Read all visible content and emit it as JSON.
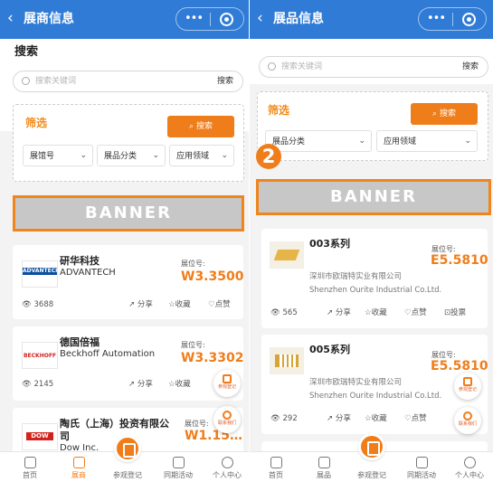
{
  "left": {
    "nav": {
      "back": "‹",
      "title": "展商信息",
      "dots": "•••"
    },
    "search": {
      "title": "搜索",
      "placeholder": "搜索关键词",
      "button": "搜索"
    },
    "filter": {
      "title": "筛选",
      "search_button": "搜索",
      "dropdowns": [
        "展馆号",
        "展品分类",
        "应用领域"
      ]
    },
    "banner": "BANNER",
    "booth_label": "展位号:",
    "cards": [
      {
        "name_cn": "研华科技",
        "name_en": "ADVANTECH",
        "logo": "ADVANTECH",
        "booth": "W3.3500",
        "views": "3688",
        "share": "分享",
        "fav": "收藏",
        "like": "点赞"
      },
      {
        "name_cn": "德国倍福",
        "name_en": "Beckhoff Automation",
        "logo": "BECKHOFF",
        "booth": "W3.3302",
        "views": "2145",
        "share": "分享",
        "fav": "收藏"
      },
      {
        "name_cn": "陶氏（上海）投资有限公",
        "name_cn2": "司",
        "name_en": "Dow Inc.",
        "logo": "DOW",
        "booth": "W1.15…"
      }
    ],
    "float_buttons": [
      "参观登记",
      "联系我们"
    ],
    "tabs": [
      {
        "label": "首页",
        "icon": "home-icon"
      },
      {
        "label": "展商",
        "icon": "exhibitor-icon"
      },
      {
        "label": "参观登记",
        "icon": "register-icon"
      },
      {
        "label": "同期活动",
        "icon": "event-icon"
      },
      {
        "label": "个人中心",
        "icon": "user-icon"
      }
    ],
    "active_tab": 1
  },
  "right": {
    "nav": {
      "back": "‹",
      "title": "展品信息",
      "dots": "•••"
    },
    "search": {
      "placeholder": "搜索关键词",
      "button": "搜索"
    },
    "filter": {
      "title": "筛选",
      "search_button": "搜索",
      "dropdowns": [
        "展品分类",
        "应用领域"
      ]
    },
    "step_badge": "2",
    "banner": "BANNER",
    "booth_label": "展位号:",
    "cards": [
      {
        "name": "003系列",
        "booth": "E5.5810",
        "company_cn": "深圳市欧瑞特实业有限公司",
        "company_en": "Shenzhen Ourite Industrial Co.Ltd.",
        "views": "565",
        "share": "分享",
        "fav": "收藏",
        "like": "点赞",
        "vote": "投票"
      },
      {
        "name": "005系列",
        "booth": "E5.5810",
        "company_cn": "深圳市欧瑞特实业有限公司",
        "company_en": "Shenzhen Ourite Industrial Co.Ltd.",
        "views": "292",
        "share": "分享",
        "fav": "收藏",
        "like": "点赞"
      }
    ],
    "float_buttons": [
      "参观登记",
      "联系我们"
    ],
    "tabs": [
      {
        "label": "首页",
        "icon": "home-icon"
      },
      {
        "label": "展品",
        "icon": "product-icon"
      },
      {
        "label": "参观登记",
        "icon": "register-icon"
      },
      {
        "label": "同期活动",
        "icon": "event-icon"
      },
      {
        "label": "个人中心",
        "icon": "user-icon"
      }
    ],
    "active_tab": -1
  },
  "colors": {
    "nav_blue": "#2f7bd6",
    "accent_orange": "#ef7d1a",
    "banner_gray": "#c7c7c7",
    "booth_orange": "#ef7d1a"
  }
}
